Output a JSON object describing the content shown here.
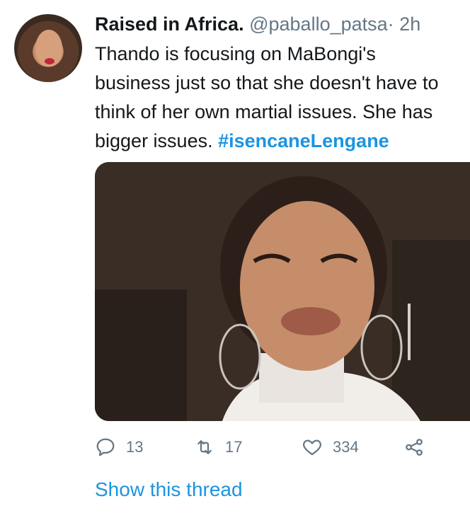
{
  "tweet": {
    "display_name": "Raised in Africa.",
    "handle": "@paballo_patsa",
    "separator": "·",
    "time": "2h",
    "text_lines": "Thando is focusing on MaBongi's\nbusiness just so that she doesn't have to\nthink of her own martial issues. She has\nbigger issues. ",
    "hashtag": "#isencaneLengane",
    "avatar_icon": "profile-photo",
    "media_icon": "photo"
  },
  "actions": {
    "reply_count": "13",
    "retweet_count": "17",
    "like_count": "334"
  },
  "show_thread_label": "Show this thread",
  "colors": {
    "link": "#1b95e0",
    "muted": "#657786",
    "text": "#14171a"
  }
}
